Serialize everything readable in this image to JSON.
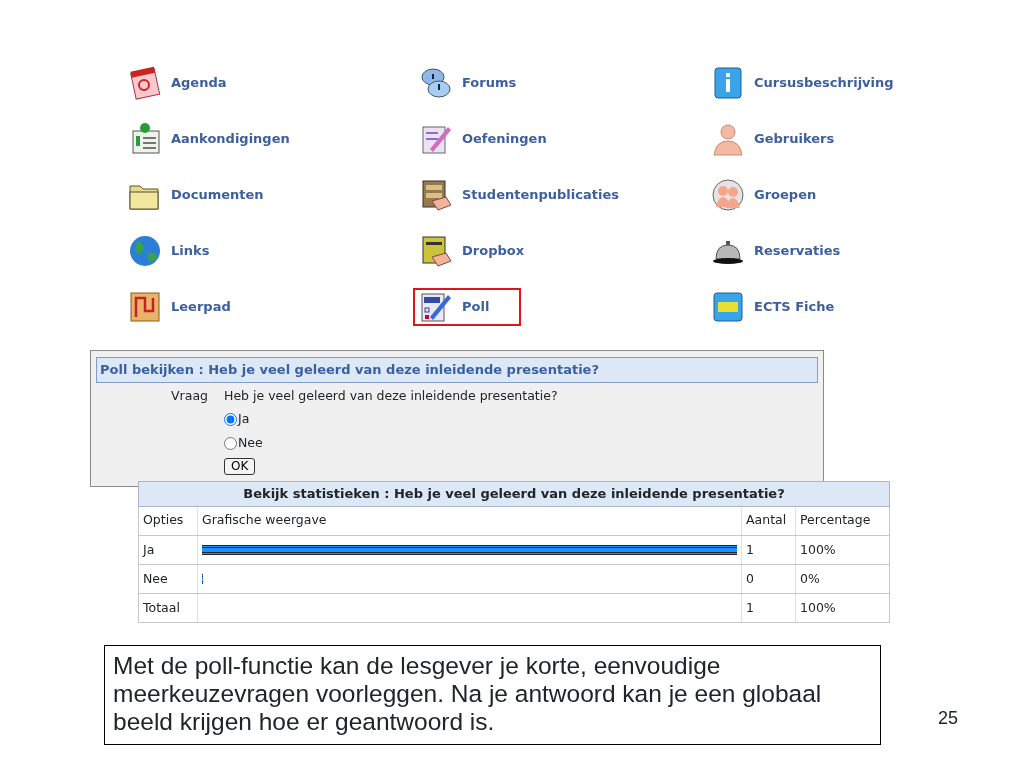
{
  "tools": [
    {
      "label": "Agenda",
      "selected": false
    },
    {
      "label": "Forums",
      "selected": false
    },
    {
      "label": "Cursusbeschrijving",
      "selected": false
    },
    {
      "label": "Aankondigingen",
      "selected": false
    },
    {
      "label": "Oefeningen",
      "selected": false
    },
    {
      "label": "Gebruikers",
      "selected": false
    },
    {
      "label": "Documenten",
      "selected": false
    },
    {
      "label": "Studentenpublicaties",
      "selected": false
    },
    {
      "label": "Groepen",
      "selected": false
    },
    {
      "label": "Links",
      "selected": false
    },
    {
      "label": "Dropbox",
      "selected": false
    },
    {
      "label": "Reservaties",
      "selected": false
    },
    {
      "label": "Leerpad",
      "selected": false
    },
    {
      "label": "Poll",
      "selected": true
    },
    {
      "label": "ECTS Fiche",
      "selected": false
    }
  ],
  "poll": {
    "title": "Poll bekijken : Heb je veel geleerd van deze inleidende presentatie?",
    "question_label": "Vraag",
    "question": "Heb je veel geleerd van deze inleidende presentatie?",
    "options": [
      {
        "label": "Ja",
        "selected": true
      },
      {
        "label": "Nee",
        "selected": false
      }
    ],
    "button": "OK"
  },
  "statistics": {
    "title": "Bekijk statistieken : Heb je veel geleerd van deze inleidende presentatie?",
    "columns": [
      "Opties",
      "Grafische weergave",
      "Aantal",
      "Percentage"
    ],
    "rows": [
      {
        "option": "Ja",
        "level": 1,
        "count": "1",
        "percentage": "100%"
      },
      {
        "option": "Nee",
        "level": 0,
        "count": "0",
        "percentage": "0%"
      }
    ],
    "total": {
      "label": "Totaal",
      "count": "1",
      "percentage": "100%"
    }
  },
  "caption": "Met de poll-functie kan de lesgever je korte, eenvoudige meerkeuzevragen voorleggen. Na je antwoord kan je een globaal beeld krijgen hoe er geantwoord is.",
  "page_number": "25"
}
